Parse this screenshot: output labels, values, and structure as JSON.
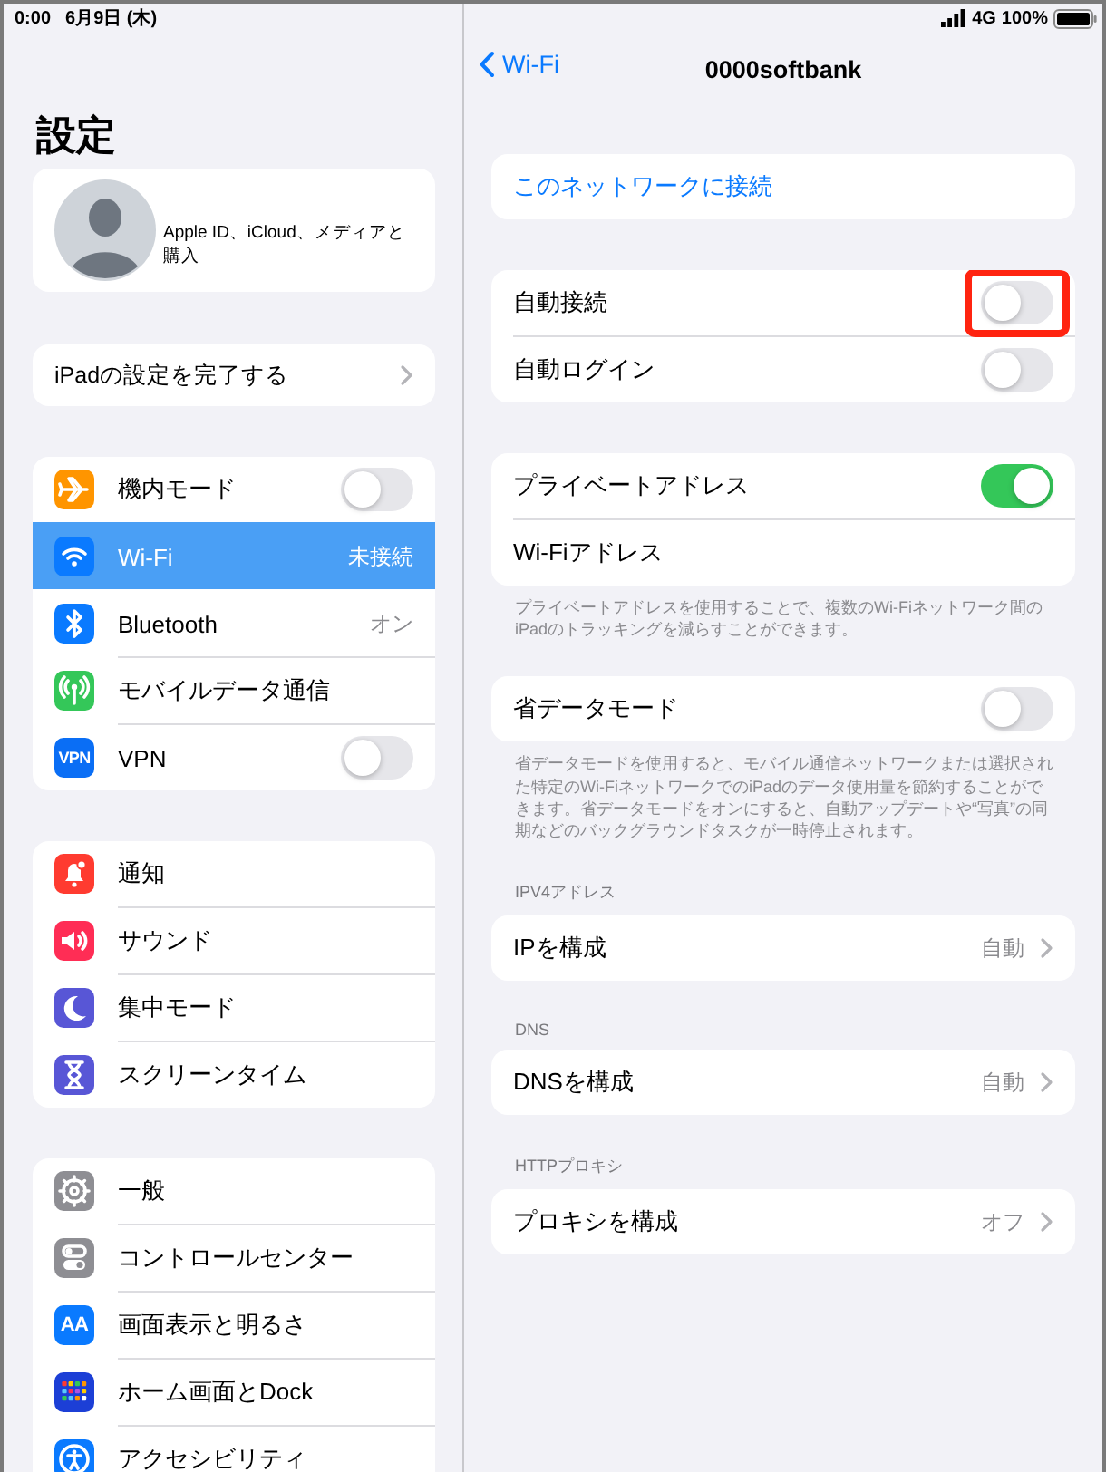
{
  "status_bar": {
    "time": "0:00",
    "date": "6月9日 (木)",
    "network": "4G",
    "battery": "100%"
  },
  "sidebar": {
    "title": "設定",
    "profile": {
      "label": "Apple ID、iCloud、メディアと購入"
    },
    "setup": {
      "label": "iPadの設定を完了する"
    },
    "groups": [
      {
        "items": [
          {
            "label": "機内モード",
            "kind": "toggle",
            "on": false,
            "selected": false,
            "color": "#ff9500"
          },
          {
            "label": "Wi-Fi",
            "kind": "value",
            "value": "未接続",
            "selected": true,
            "color": "#0a7aff"
          },
          {
            "label": "Bluetooth",
            "kind": "value",
            "value": "オン",
            "selected": false,
            "color": "#0a7aff"
          },
          {
            "label": "モバイルデータ通信",
            "kind": "plain",
            "selected": false,
            "color": "#34c759"
          },
          {
            "label": "VPN",
            "kind": "toggle",
            "on": false,
            "selected": false,
            "color": "#0a6ef5",
            "icon_text": "VPN"
          }
        ]
      },
      {
        "items": [
          {
            "label": "通知",
            "kind": "plain",
            "selected": false,
            "color": "#ff3b30"
          },
          {
            "label": "サウンド",
            "kind": "plain",
            "selected": false,
            "color": "#ff2d55"
          },
          {
            "label": "集中モード",
            "kind": "plain",
            "selected": false,
            "color": "#5856d6"
          },
          {
            "label": "スクリーンタイム",
            "kind": "plain",
            "selected": false,
            "color": "#5856d6"
          }
        ]
      },
      {
        "items": [
          {
            "label": "一般",
            "kind": "plain",
            "selected": false,
            "color": "#8e8e93"
          },
          {
            "label": "コントロールセンター",
            "kind": "plain",
            "selected": false,
            "color": "#8e8e93"
          },
          {
            "label": "画面表示と明るさ",
            "kind": "plain",
            "selected": false,
            "color": "#0a7aff",
            "icon_text": "AA"
          },
          {
            "label": "ホーム画面とDock",
            "kind": "plain",
            "selected": false,
            "color": "#1c3fd6"
          },
          {
            "label": "アクセシビリティ",
            "kind": "plain",
            "selected": false,
            "color": "#0a7aff"
          }
        ]
      }
    ]
  },
  "detail": {
    "back": "Wi-Fi",
    "title": "0000softbank",
    "sections": [
      {
        "rows": [
          {
            "label": "このネットワークに接続",
            "kind": "action"
          }
        ]
      },
      {
        "rows": [
          {
            "label": "自動接続",
            "kind": "toggle",
            "on": false,
            "highlighted": true
          },
          {
            "label": "自動ログイン",
            "kind": "toggle",
            "on": false,
            "highlighted": false
          }
        ]
      },
      {
        "rows": [
          {
            "label": "プライベートアドレス",
            "kind": "toggle",
            "on": true,
            "highlighted": false
          },
          {
            "label": "Wi-Fiアドレス",
            "kind": "plain"
          }
        ],
        "footer": "プライベートアドレスを使用することで、複数のWi-Fiネットワーク間のiPadのトラッキングを減らすことができます。"
      },
      {
        "rows": [
          {
            "label": "省データモード",
            "kind": "toggle",
            "on": false,
            "highlighted": false
          }
        ],
        "footer": "省データモードを使用すると、モバイル通信ネットワークまたは選択された特定のWi-FiネットワークでのiPadのデータ使用量を節約することができます。省データモードをオンにすると、自動アップデートや“写真”の同期などのバックグラウンドタスクが一時停止されます。"
      },
      {
        "header": "IPV4アドレス",
        "rows": [
          {
            "label": "IPを構成",
            "kind": "value",
            "value": "自動"
          }
        ]
      },
      {
        "header": "DNS",
        "rows": [
          {
            "label": "DNSを構成",
            "kind": "value",
            "value": "自動"
          }
        ]
      },
      {
        "header": "HTTPプロキシ",
        "rows": [
          {
            "label": "プロキシを構成",
            "kind": "value",
            "value": "オフ"
          }
        ]
      }
    ]
  }
}
